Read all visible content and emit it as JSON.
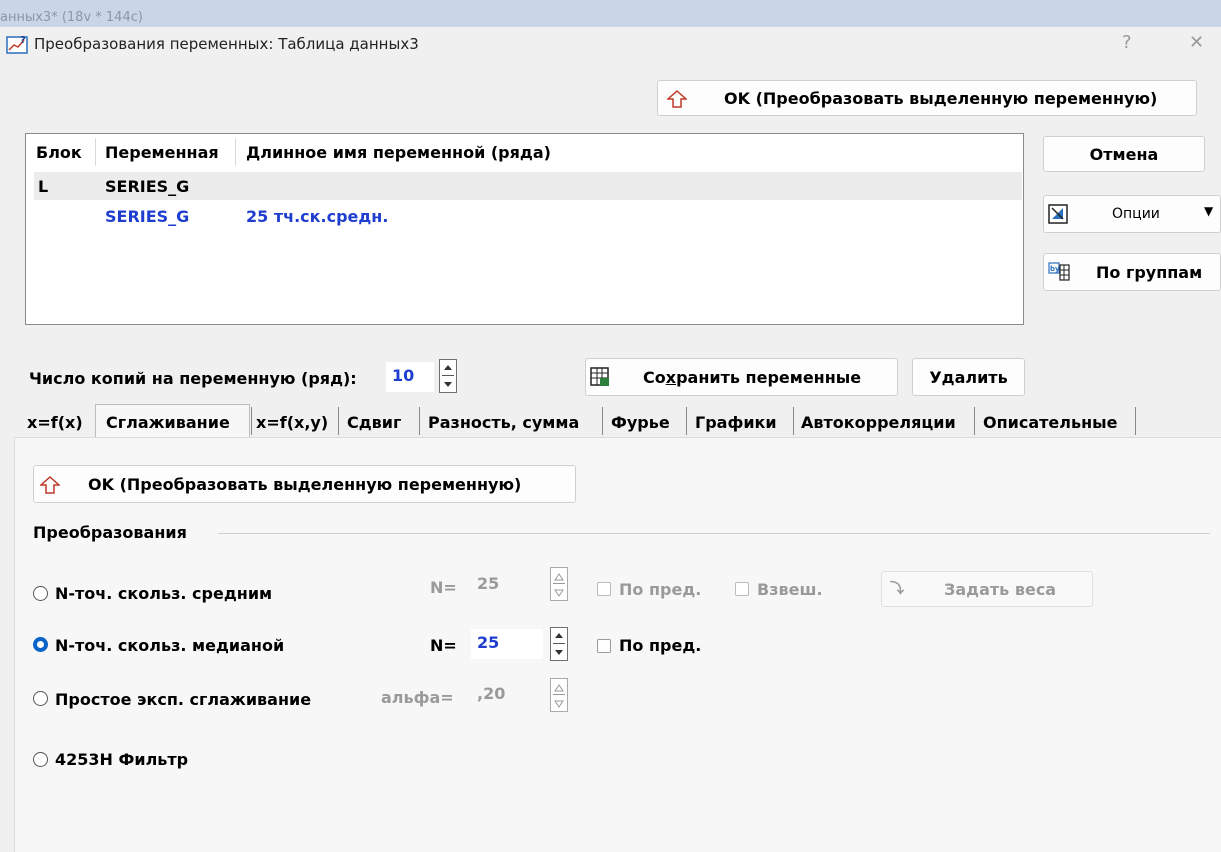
{
  "background_window": {
    "title_fragment": "анных3* (18v * 144c)"
  },
  "dialog": {
    "title": "Преобразования переменных: Таблица данных3",
    "help_glyph": "?",
    "close_glyph": "✕"
  },
  "top_ok_button": {
    "label": "OK (Преобразовать выделенную переменную)",
    "icon": "up-arrow-outline-icon"
  },
  "variable_list": {
    "columns": [
      "Блок",
      "Переменная",
      "Длинное имя переменной (ряда)"
    ],
    "rows": [
      {
        "block": "L",
        "variable": "SERIES_G",
        "long_name": ""
      },
      {
        "block": "",
        "variable": "SERIES_G",
        "long_name": "25 тч.ск.средн."
      }
    ],
    "highlight_color": "#1f3ecf"
  },
  "side_buttons": {
    "cancel": "Отмена",
    "options": "Опции",
    "by_groups": "По группам"
  },
  "copies": {
    "label": "Число копий на переменную (ряд):",
    "value": "10"
  },
  "save_button": {
    "label_pre": "Со",
    "label_underlined": "х",
    "label_post": "ранить переменные"
  },
  "delete_button": "Удалить",
  "tabs": [
    "x=f(x)",
    "Сглаживание",
    "x=f(x,y)",
    "Сдвиг",
    "Разность, сумма",
    "Фурье",
    "Графики",
    "Автокорреляции",
    "Описательные"
  ],
  "active_tab": "Сглаживание",
  "panel": {
    "ok_button": "OK (Преобразовать выделенную переменную)",
    "group_label": "Преобразования",
    "options": [
      {
        "label": "N-точ. скольз. средним",
        "param_label": "N=",
        "param_value": "25",
        "checks": [
          "По пред.",
          "Взвеш."
        ],
        "weights_button": "Задать веса",
        "selected": false
      },
      {
        "label": "N-точ. скольз. медианой",
        "param_label": "N=",
        "param_value": "25",
        "checks": [
          "По пред."
        ],
        "selected": true
      },
      {
        "label": "Простое эксп. сглаживание",
        "param_label": "альфа=",
        "param_value": ",20",
        "selected": false
      },
      {
        "label": "4253H Фильтр",
        "selected": false
      }
    ]
  }
}
